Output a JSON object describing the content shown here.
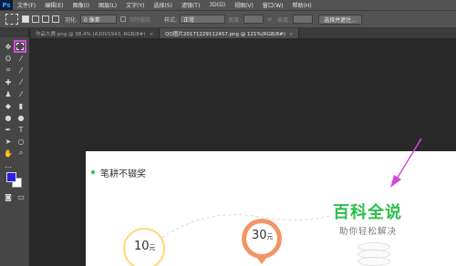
{
  "menubar": {
    "logo": "Ps",
    "items": [
      "文件(F)",
      "编辑(E)",
      "图像(I)",
      "图层(L)",
      "文字(Y)",
      "选择(S)",
      "滤镜(T)",
      "3D(D)",
      "视图(V)",
      "窗口(W)",
      "帮助(H)"
    ]
  },
  "options": {
    "feather_label": "羽化:",
    "feather_value": "0 像素",
    "antialias_label": "消除锯齿",
    "style_label": "样式:",
    "style_value": "正常",
    "width_label": "宽度:",
    "height_label": "高度:",
    "select_mask_button": "选择并遮住..."
  },
  "tabs": [
    {
      "label": "作品大赛.png @ 38.4% (A30V1943, RGB/8#)",
      "close": "×"
    },
    {
      "label": "QQ图片20171229112457.png @ 121%(RGB/8#)",
      "close": "×"
    }
  ],
  "document": {
    "heading": "笔耕不辍奖",
    "brand_title": "百科全说",
    "brand_subtitle": "助你轻松解决",
    "amount_1": "10",
    "amount_2": "30",
    "currency": "元"
  },
  "colors": {
    "foreground": "#2d1fe0",
    "background": "#ffffff",
    "brand_green": "#2bbf4a",
    "highlight": "#d04cd8"
  }
}
